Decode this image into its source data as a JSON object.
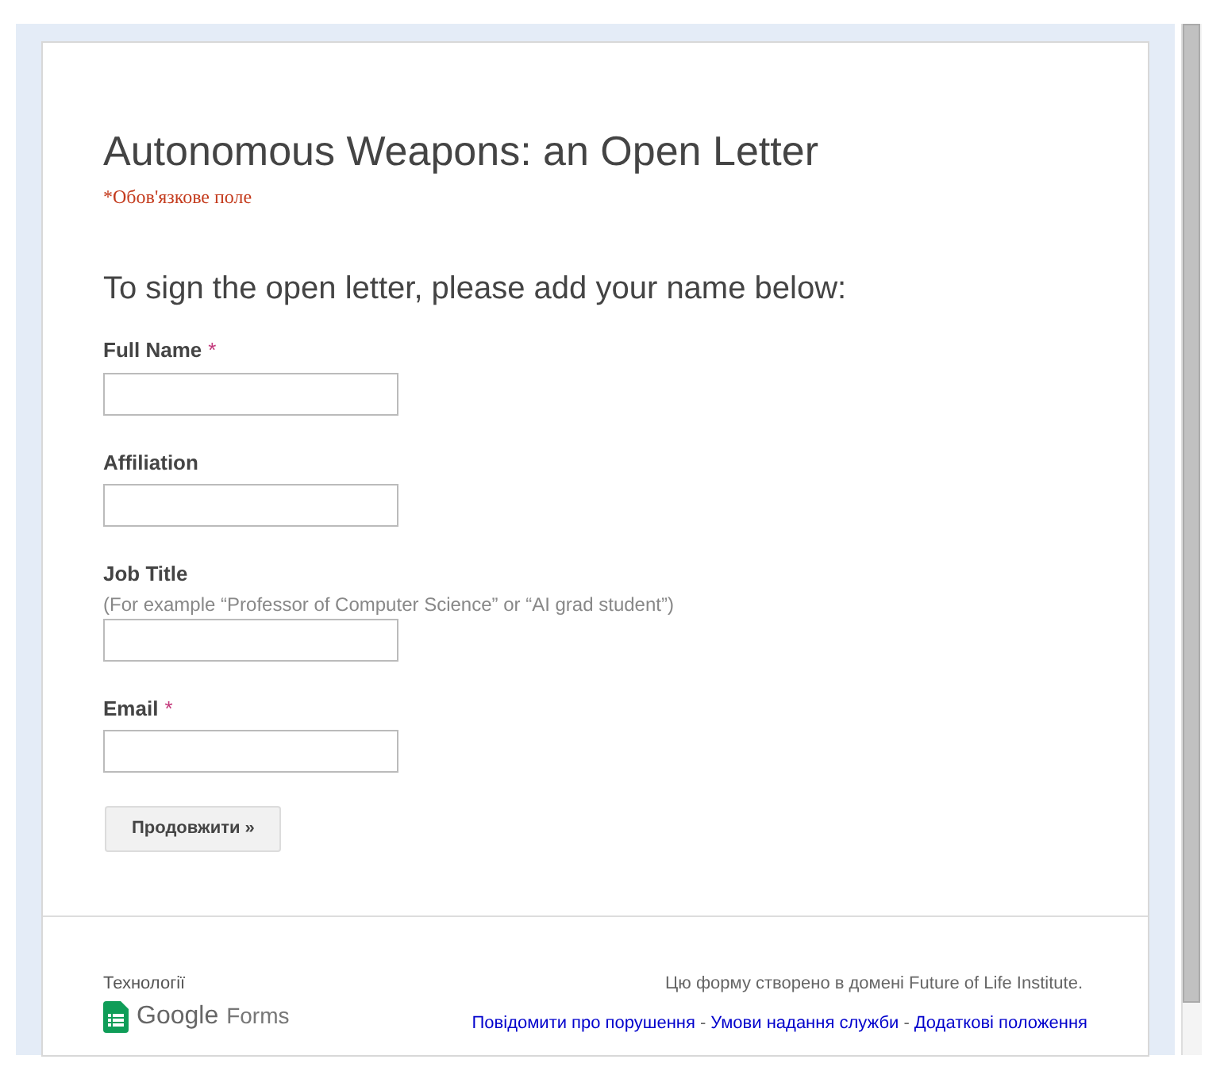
{
  "form": {
    "title": "Autonomous Weapons: an Open Letter",
    "required_note": "*Обов'язкове поле",
    "section_title": "To sign the open letter, please add your name below:",
    "fields": [
      {
        "label": "Full Name",
        "required_mark": "*"
      },
      {
        "label": "Affiliation"
      },
      {
        "label": "Job Title",
        "help": "(For example “Professor of Computer Science” or “AI grad student”)"
      },
      {
        "label": "Email",
        "required_mark": "*"
      }
    ],
    "continue_button": "Продовжити »"
  },
  "footer": {
    "powered_by": "Технології",
    "logo_text": "Google",
    "logo_product": "Forms",
    "domain_note": "Цю форму створено в домені Future of Life Institute.",
    "links": [
      "Повідомити про порушення",
      "Умови надання служби",
      "Додаткові положення"
    ],
    "separator": "-"
  }
}
